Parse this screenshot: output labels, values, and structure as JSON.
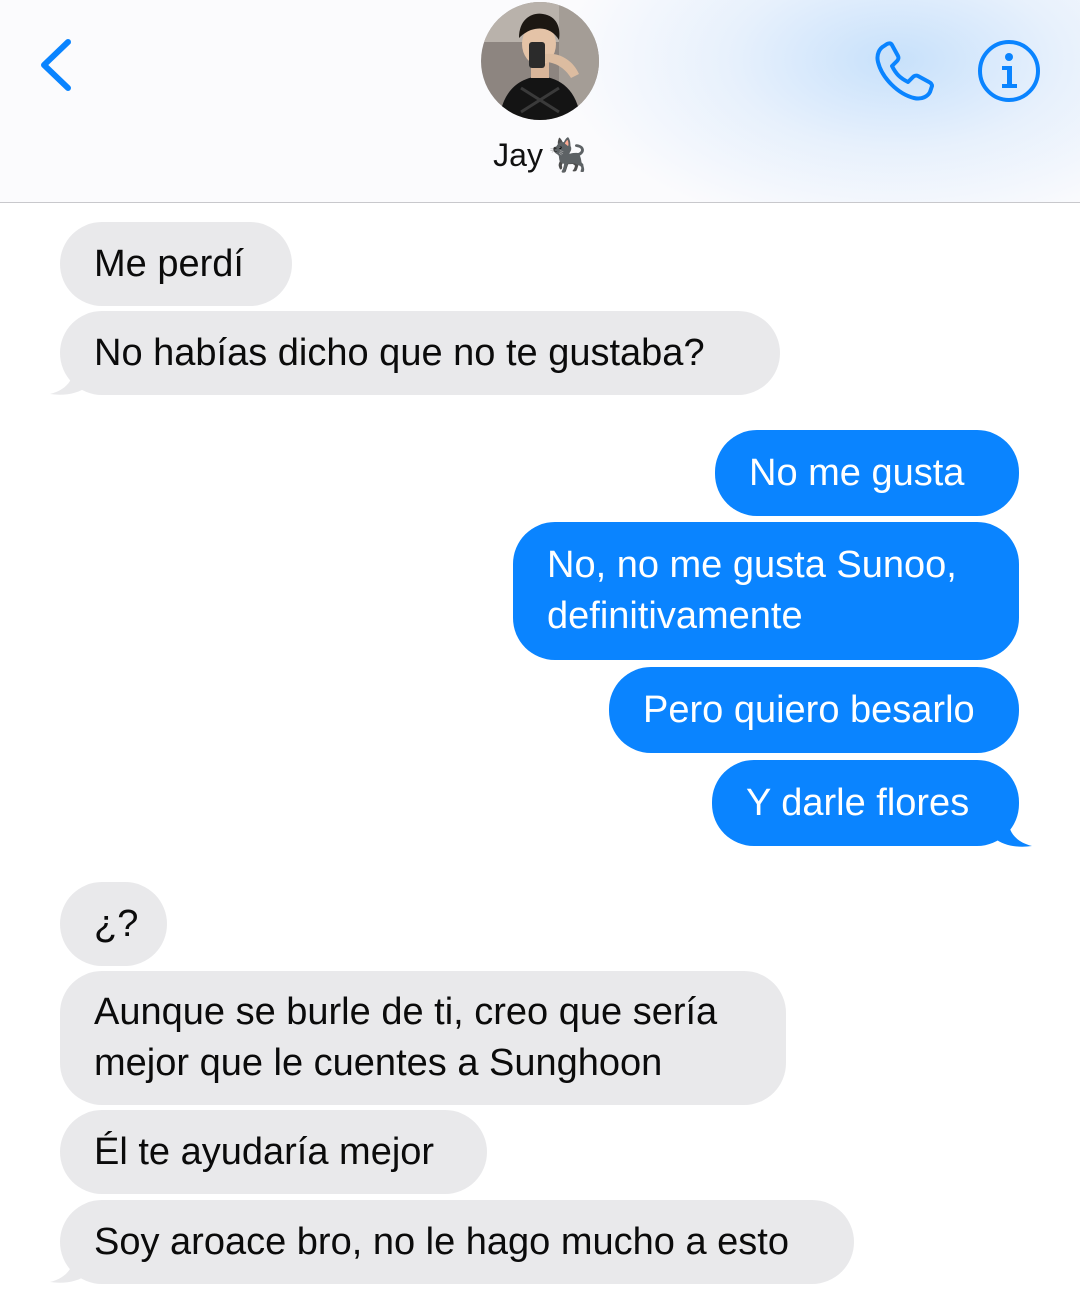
{
  "header": {
    "contact_name": "Jay",
    "contact_emoji": "🐈‍⬛",
    "back_icon": "chevron-left-icon",
    "call_icon": "phone-icon",
    "info_icon": "info-icon",
    "accent_color": "#0a84ff"
  },
  "messages": [
    {
      "from": "them",
      "text": "Me perdí"
    },
    {
      "from": "them",
      "text": "No habías dicho que no te gustaba?"
    },
    {
      "from": "me",
      "text": "No me gusta"
    },
    {
      "from": "me",
      "lines": [
        "No, no me gusta Sunoo,",
        "definitivamente"
      ]
    },
    {
      "from": "me",
      "text": "Pero quiero besarlo"
    },
    {
      "from": "me",
      "text": "Y darle flores"
    },
    {
      "from": "them",
      "text": "¿?"
    },
    {
      "from": "them",
      "lines": [
        "Aunque se burle de ti, creo que sería",
        "mejor que le cuentes a Sunghoon"
      ]
    },
    {
      "from": "them",
      "text": "Él te ayudaría mejor"
    },
    {
      "from": "them",
      "text": "Soy aroace bro, no le hago mucho a esto"
    }
  ],
  "colors": {
    "incoming_bubble": "#e9e9eb",
    "outgoing_bubble": "#0a84ff"
  }
}
